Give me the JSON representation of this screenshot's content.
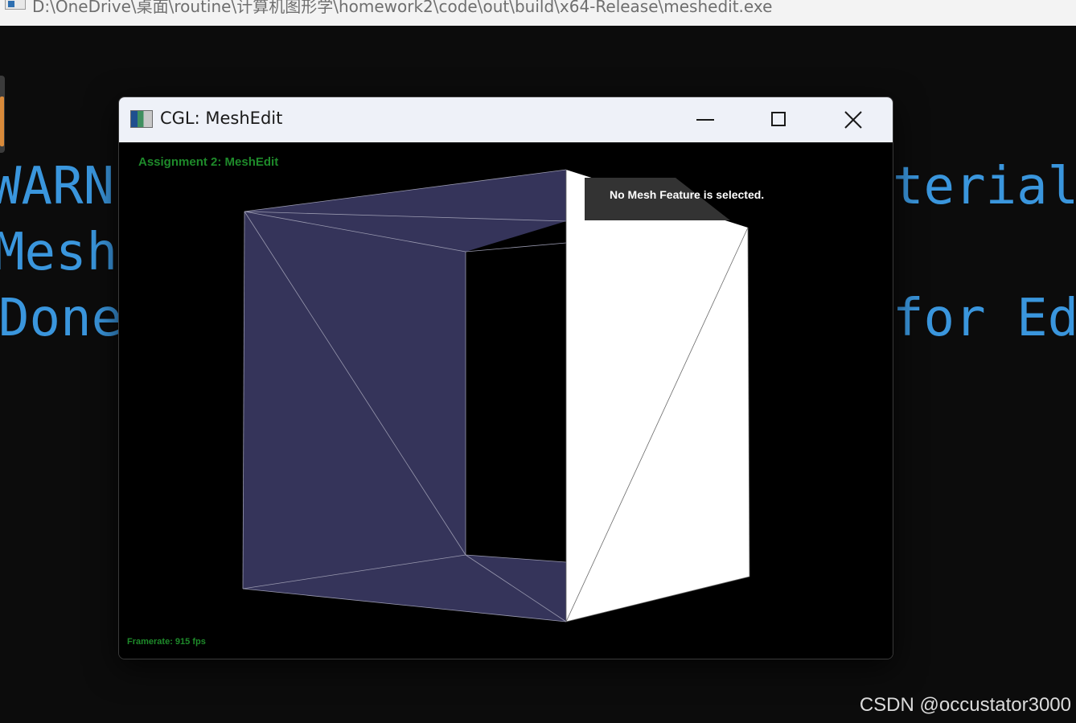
{
  "console": {
    "title": "D:\\OneDrive\\桌面\\routine\\计算机图形学\\homework2\\code\\out\\build\\x64-Release\\meshedit.exe",
    "lines": [
      {
        "left": "WARNI",
        "right": "terial:"
      },
      {
        "left": "MeshE",
        "right": ""
      },
      {
        "left": "Done ",
        "right": "for Edi"
      }
    ],
    "text_color": "#3a96dd"
  },
  "app": {
    "title": "CGL: MeshEdit",
    "buttons": {
      "minimize": "minimize",
      "maximize": "maximize",
      "close": "close"
    },
    "viewport": {
      "assignment_title": "Assignment 2: MeshEdit",
      "status_message": "No Mesh Feature is selected.",
      "framerate": "Framerate: 915 fps"
    },
    "colors": {
      "face": "#35345a",
      "face_lit": "#ffffff",
      "edge": "#9a9ab0",
      "label_green": "#1e8a2a",
      "status_bg": "#333333"
    }
  },
  "watermark": "CSDN @occustator3000"
}
